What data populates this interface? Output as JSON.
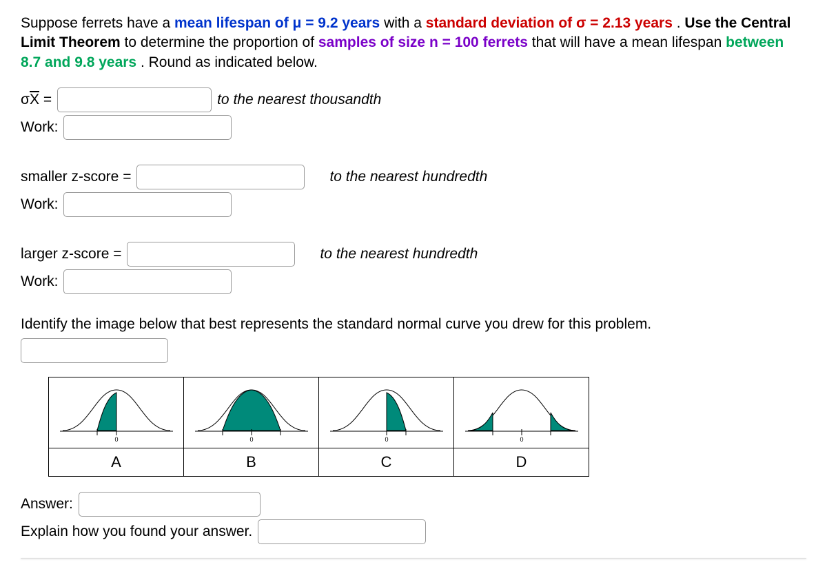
{
  "question": {
    "p1_a": "Suppose ferrets have a ",
    "p1_blue": "mean lifespan of μ = 9.2 years",
    "p1_b": " with a ",
    "p1_red": "standard deviation of σ = 2.13 years",
    "p1_c": ".  ",
    "p1_bold1": "Use the Central Limit Theorem",
    "p1_d": " to determine the proportion of ",
    "p1_purple": "samples of size n = 100 ferrets",
    "p1_e": " that will have a mean lifespan ",
    "p1_green": "between 8.7 and 9.8 years",
    "p1_f": ".  Round as indicated below."
  },
  "labels": {
    "sigma_xbar_prefix": "σ",
    "sigma_xbar_x": "X",
    "equals": " = ",
    "hint_thousandth": "to the nearest thousandth",
    "work": "Work:",
    "smaller_z": "smaller z-score  = ",
    "hint_hundredth": "to the nearest hundredth",
    "larger_z": "larger z-score  = ",
    "identify": "Identify the image below that best represents the standard normal curve you drew for this problem.",
    "answer": "Answer:",
    "explain": "Explain how you found your answer.",
    "A": "A",
    "B": "B",
    "C": "C",
    "D": "D"
  },
  "colors": {
    "fill": "#008a7a"
  }
}
